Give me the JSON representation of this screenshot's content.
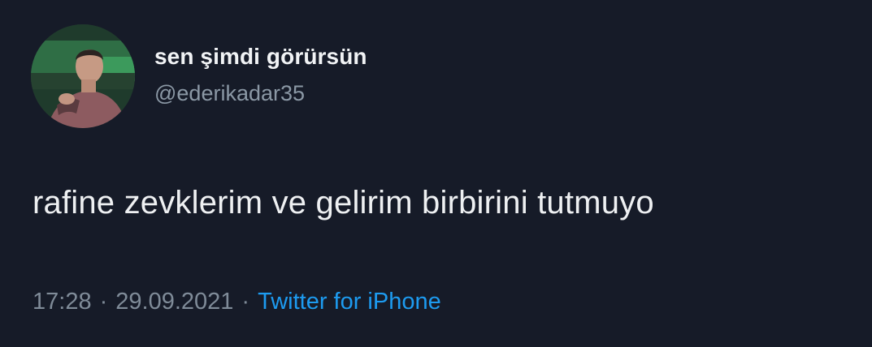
{
  "tweet": {
    "author": {
      "display_name": "sen şimdi görürsün",
      "handle": "@ederikadar35"
    },
    "text": "rafine zevklerim ve gelirim birbirini tutmuyo",
    "time": "17:28",
    "separator": "·",
    "date": "29.09.2021",
    "source": "Twitter for iPhone"
  },
  "colors": {
    "background": "#161b28",
    "text": "#eef0f2",
    "muted": "#7f8b98",
    "link": "#1d9bf0"
  }
}
